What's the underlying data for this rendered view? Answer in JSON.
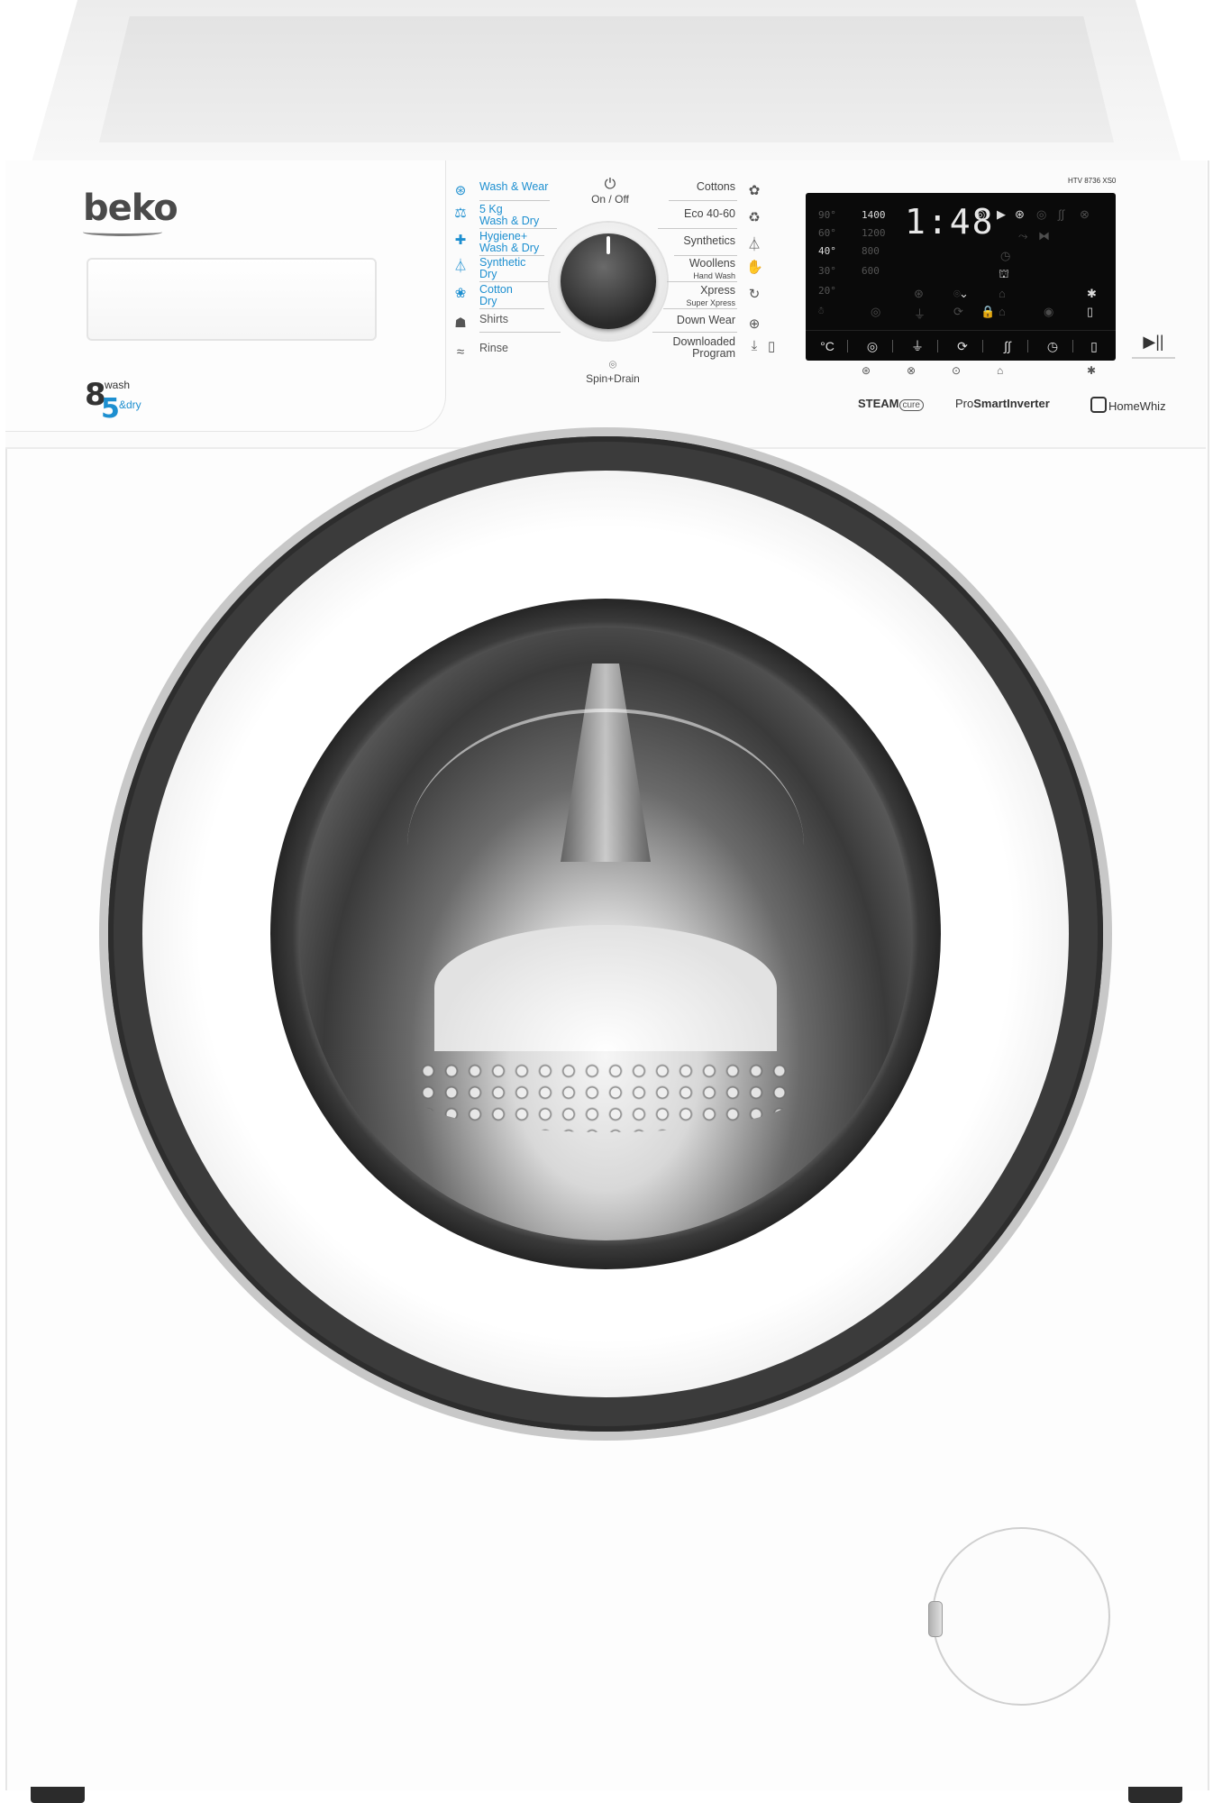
{
  "brand": {
    "logo": "beko"
  },
  "capacity": {
    "wash_kg": "8",
    "wash_label": "wash",
    "dry_kg": "5",
    "dry_label": "&dry"
  },
  "dial": {
    "on_off_label": "On / Off",
    "spin_drain_label": "Spin+Drain"
  },
  "programs_left": [
    {
      "label": "Wash & Wear",
      "icon": "wash-wear-icon",
      "glyph": "⊛"
    },
    {
      "label": "5 Kg",
      "label2": "Wash & Dry",
      "icon": "wash-dry-5kg-icon",
      "glyph": "⚖"
    },
    {
      "label": "Hygiene+",
      "label2": "Wash & Dry",
      "icon": "hygiene-icon",
      "glyph": "✚"
    },
    {
      "label": "Synthetic",
      "label2": "Dry",
      "icon": "synthetic-dry-icon",
      "glyph": "⏃"
    },
    {
      "label": "Cotton",
      "label2": "Dry",
      "icon": "cotton-dry-icon",
      "glyph": "❀"
    },
    {
      "label": "Shirts",
      "icon": "shirt-icon",
      "glyph": "☗"
    },
    {
      "label": "Rinse",
      "icon": "rinse-icon",
      "glyph": "≈"
    }
  ],
  "programs_right": [
    {
      "label": "Cottons",
      "icon": "cotton-icon",
      "glyph": "✿"
    },
    {
      "label": "Eco 40-60",
      "icon": "eco-icon",
      "glyph": "♻"
    },
    {
      "label": "Synthetics",
      "icon": "synthetics-icon",
      "glyph": "⏃"
    },
    {
      "label": "Woollens",
      "sub": "Hand Wash",
      "icon": "woollens-icon",
      "glyph": "✋"
    },
    {
      "label": "Xpress",
      "sub": "Super Xpress",
      "icon": "xpress-icon",
      "glyph": "↻"
    },
    {
      "label": "Down Wear",
      "icon": "down-wear-icon",
      "glyph": "⊕"
    },
    {
      "label": "Downloaded",
      "label2": "Program",
      "icon": "download-icon",
      "glyph": "⤓"
    }
  ],
  "display": {
    "model": "HTV 8736 XS0",
    "time": "1:48",
    "temperatures": [
      "90°",
      "60°",
      "40°",
      "30°",
      "20°",
      "☃"
    ],
    "active_temperature": "40°",
    "spins": [
      "1400",
      "1200",
      "800",
      "600"
    ],
    "active_spin": "1400",
    "buttons": [
      {
        "name": "temperature-button",
        "glyph": "°C"
      },
      {
        "name": "spin-speed-button",
        "glyph": "◎"
      },
      {
        "name": "prewash-button",
        "glyph": "⏚"
      },
      {
        "name": "quick-wash-button",
        "glyph": "⟳"
      },
      {
        "name": "steam-button",
        "glyph": "∫∫"
      },
      {
        "name": "delay-timer-button",
        "glyph": "◷"
      },
      {
        "name": "remote-control-button",
        "glyph": "▯"
      }
    ]
  },
  "sub_icons": [
    "⊛",
    "⊗",
    "⊙",
    "⌂",
    "✱"
  ],
  "start_pause": {
    "glyph": "▶||"
  },
  "badges": {
    "steam": "STEAM",
    "steam_cure": "cure",
    "inverter_pro": "Pro",
    "inverter_main": "SmartInverter",
    "homewhiz": "HomeWhiz"
  },
  "colors": {
    "accent_blue": "#1d8fd0",
    "display_bg": "#0a0a0a",
    "door_ring": "#3b3b3b"
  }
}
